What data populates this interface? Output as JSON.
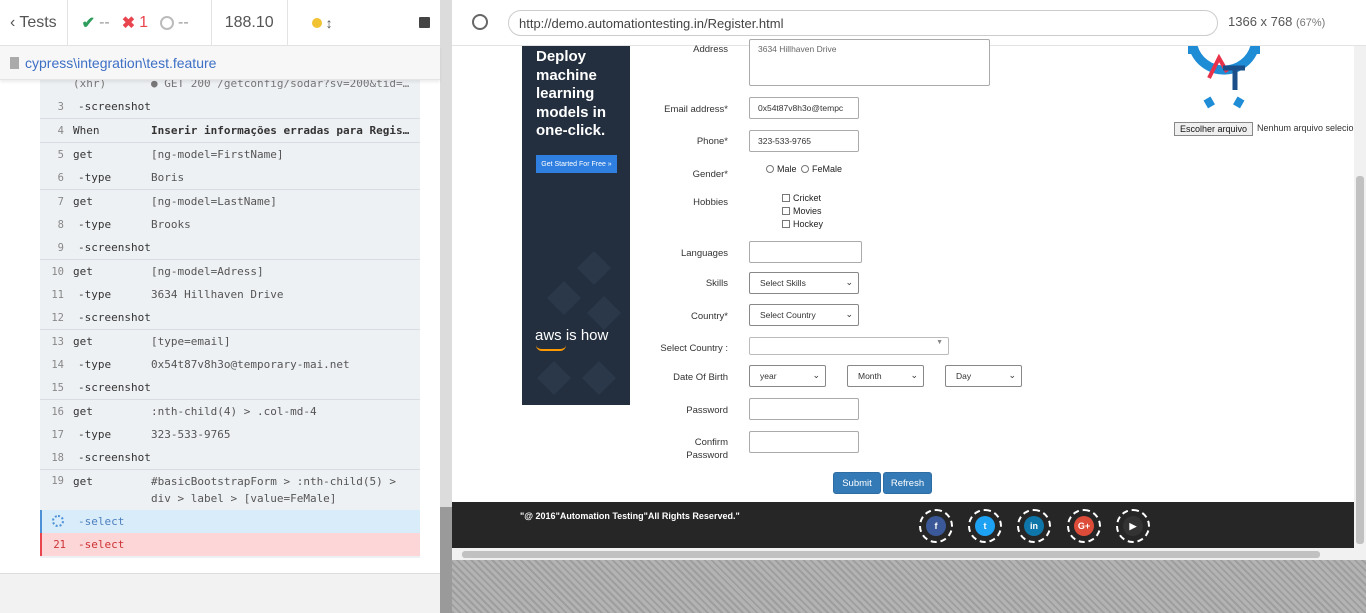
{
  "runner": {
    "back_label": "Tests",
    "passed": "--",
    "failed": "1",
    "pending": "--",
    "duration": "188.10",
    "spec_path": "cypress\\integration\\test.feature",
    "commands": [
      {
        "num": "",
        "name": "(xhr)",
        "msg": "● GET 200 /getconfig/sodar?sv=200&tid=..."
      },
      {
        "num": "3",
        "name": "-screenshot",
        "msg": ""
      },
      {
        "num": "4",
        "name": "When",
        "msg": "Inserir informações erradas para Regis..."
      },
      {
        "num": "5",
        "name": "get",
        "msg": "[ng-model=FirstName]"
      },
      {
        "num": "6",
        "name": "-type",
        "msg": "Boris"
      },
      {
        "num": "7",
        "name": "get",
        "msg": "[ng-model=LastName]"
      },
      {
        "num": "8",
        "name": "-type",
        "msg": "Brooks"
      },
      {
        "num": "9",
        "name": "-screenshot",
        "msg": ""
      },
      {
        "num": "10",
        "name": "get",
        "msg": "[ng-model=Adress]"
      },
      {
        "num": "11",
        "name": "-type",
        "msg": "3634 Hillhaven Drive"
      },
      {
        "num": "12",
        "name": "-screenshot",
        "msg": ""
      },
      {
        "num": "13",
        "name": "get",
        "msg": "[type=email]"
      },
      {
        "num": "14",
        "name": "-type",
        "msg": "0x54t87v8h3o@temporary-mai.net"
      },
      {
        "num": "15",
        "name": "-screenshot",
        "msg": ""
      },
      {
        "num": "16",
        "name": "get",
        "msg": ":nth-child(4) > .col-md-4"
      },
      {
        "num": "17",
        "name": "-type",
        "msg": "323-533-9765"
      },
      {
        "num": "18",
        "name": "-screenshot",
        "msg": ""
      },
      {
        "num": "19",
        "name": "get",
        "msg": "#basicBootstrapForm > :nth-child(5) >",
        "msg2": "div > label > [value=FeMale]"
      },
      {
        "num": "",
        "name": "-select",
        "msg": ""
      },
      {
        "num": "21",
        "name": "-select",
        "msg": ""
      }
    ]
  },
  "browser": {
    "url": "http://demo.automationtesting.in/Register.html",
    "viewport": "1366 x 768",
    "scale": "(67%)"
  },
  "ad": {
    "title": "Deploy machine learning models in one-click.",
    "button": "Get Started For Free »",
    "brand": "aws is how"
  },
  "form": {
    "address_label": "Address",
    "address_value": "3634 Hillhaven Drive",
    "email_label": "Email address*",
    "email_value": "0x54t87v8h3o@tempc",
    "phone_label": "Phone*",
    "phone_value": "323-533-9765",
    "gender_label": "Gender*",
    "gender_male": "Male",
    "gender_female": "FeMale",
    "hobbies_label": "Hobbies",
    "hobby_cricket": "Cricket",
    "hobby_movies": "Movies",
    "hobby_hockey": "Hockey",
    "languages_label": "Languages",
    "skills_label": "Skills",
    "skills_value": "Select Skills",
    "country_label": "Country*",
    "country_value": "Select Country",
    "select_country_label": "Select Country :",
    "dob_label": "Date Of Birth",
    "year": "year",
    "month": "Month",
    "day": "Day",
    "password_label": "Password",
    "confirm_label_1": "Confirm",
    "confirm_label_2": "Password",
    "submit": "Submit",
    "refresh": "Refresh",
    "upload_button": "Escolher arquivo",
    "upload_none": "Nenhum arquivo selecionado"
  },
  "footer": {
    "copyright": "\"@ 2016\"Automation Testing\"All Rights Reserved.\""
  },
  "colors": {
    "accent": "#337ab7",
    "failed": "#e8454f",
    "passed": "#2e9c5c",
    "ad_bg": "#232f3e"
  }
}
